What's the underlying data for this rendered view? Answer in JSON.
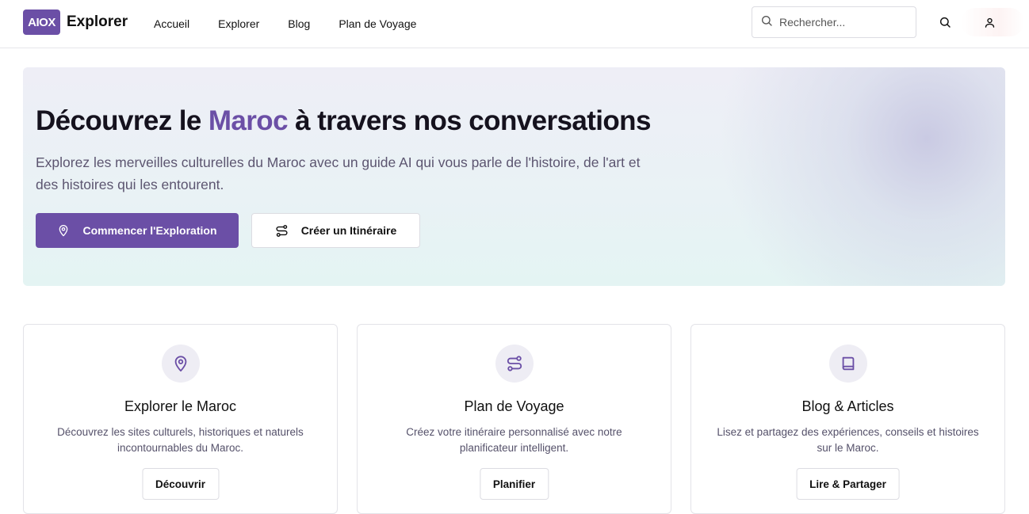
{
  "header": {
    "logo_badge": "AIOX",
    "logo_text": "Explorer",
    "nav": [
      "Accueil",
      "Explorer",
      "Blog",
      "Plan de Voyage"
    ],
    "search_placeholder": "Rechercher...",
    "icons": [
      "search-icon",
      "user-icon"
    ]
  },
  "hero": {
    "title_before": "Découvrez le ",
    "title_accent": "Maroc",
    "title_after": " à travers nos conversations",
    "subtitle": "Explorez les merveilles culturelles du Maroc avec un guide AI qui vous parle de l'histoire, de l'art et des histoires qui les entourent.",
    "primary_button": "Commencer l'Exploration",
    "secondary_button": "Créer un Itinéraire"
  },
  "cards": [
    {
      "icon": "map-pin-icon",
      "title": "Explorer le Maroc",
      "description": "Découvrez les sites culturels, historiques et naturels incontournables du Maroc.",
      "button": "Découvrir"
    },
    {
      "icon": "route-icon",
      "title": "Plan de Voyage",
      "description": "Créez votre itinéraire personnalisé avec notre planificateur intelligent.",
      "button": "Planifier"
    },
    {
      "icon": "book-icon",
      "title": "Blog & Articles",
      "description": "Lisez et partagez des expériences, conseils et histoires sur le Maroc.",
      "button": "Lire & Partager"
    }
  ],
  "colors": {
    "accent": "#6b4fa6",
    "text": "#15121e",
    "muted": "#5c5570"
  }
}
